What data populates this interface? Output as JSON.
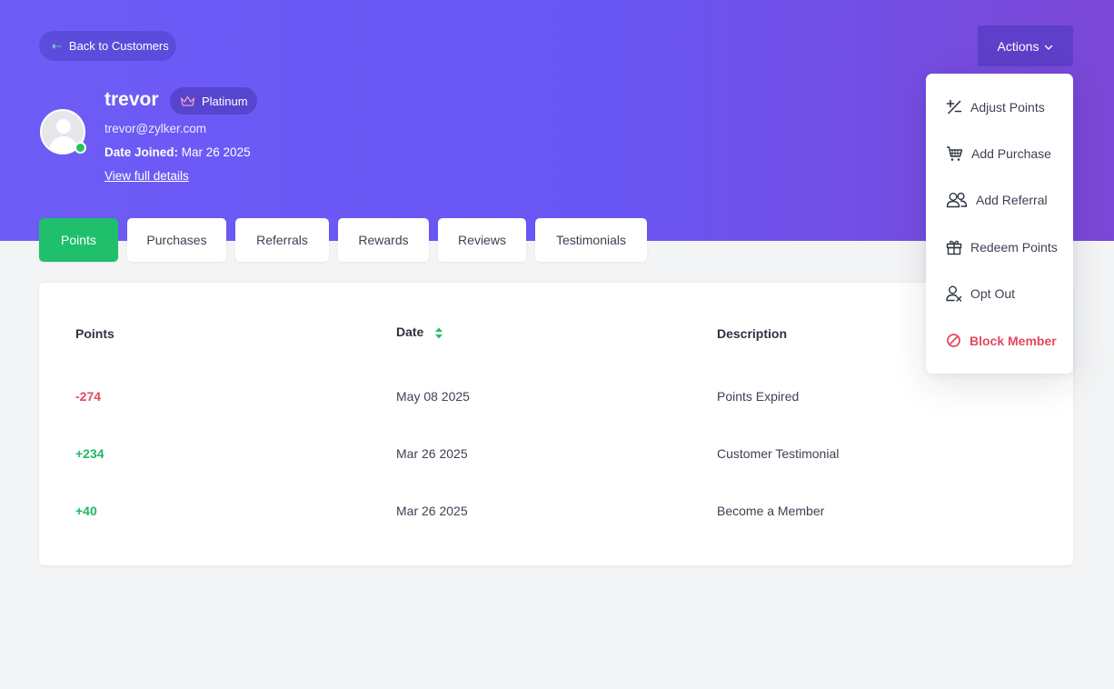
{
  "header": {
    "back_label": "Back to Customers",
    "actions_label": "Actions"
  },
  "customer": {
    "name": "trevor",
    "tier": "Platinum",
    "email": "trevor@zylker.com",
    "date_joined_label": "Date Joined:",
    "date_joined": "Mar 26 2025",
    "view_details_label": "View full details",
    "status": "online"
  },
  "tabs": [
    {
      "label": "Points",
      "active": true
    },
    {
      "label": "Purchases",
      "active": false
    },
    {
      "label": "Referrals",
      "active": false
    },
    {
      "label": "Rewards",
      "active": false
    },
    {
      "label": "Reviews",
      "active": false
    },
    {
      "label": "Testimonials",
      "active": false
    }
  ],
  "table": {
    "columns": [
      "Points",
      "Date",
      "Description"
    ],
    "rows": [
      {
        "points": "-274",
        "date": "May 08 2025",
        "description": "Points Expired"
      },
      {
        "points": "+234",
        "date": "Mar 26 2025",
        "description": "Customer Testimonial"
      },
      {
        "points": "+40",
        "date": "Mar 26 2025",
        "description": "Become a Member"
      }
    ]
  },
  "actions_menu": [
    {
      "label": "Adjust Points",
      "icon": "plus-minus-icon"
    },
    {
      "label": "Add Purchase",
      "icon": "cart-icon"
    },
    {
      "label": "Add Referral",
      "icon": "users-icon"
    },
    {
      "label": "Redeem Points",
      "icon": "gift-icon"
    },
    {
      "label": "Opt Out",
      "icon": "user-x-icon"
    },
    {
      "label": "Block Member",
      "icon": "block-icon"
    }
  ],
  "colors": {
    "brand": "#6e5cf7",
    "active_tab": "#20bf6b",
    "negative": "#e5485e",
    "positive": "#1fb866"
  }
}
